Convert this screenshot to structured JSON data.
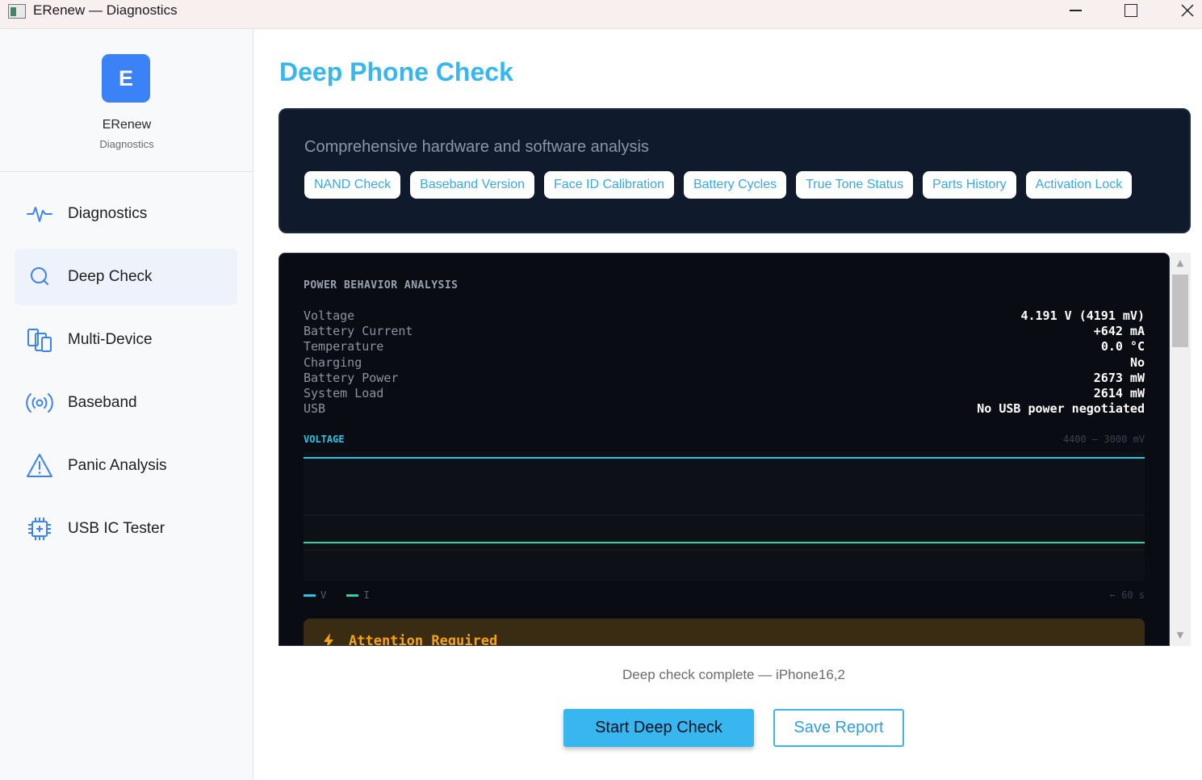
{
  "window": {
    "title": "ERenew — Diagnostics",
    "controls": [
      "minimize-icon",
      "maximize-icon",
      "close-icon"
    ]
  },
  "sidebar": {
    "logo_letter": "E",
    "brand_name": "ERenew",
    "brand_sub": "Diagnostics",
    "accent": "#3b82f6",
    "active_index": 1,
    "items": [
      {
        "label": "Diagnostics",
        "icon": "activity-pulse-icon"
      },
      {
        "label": "Deep Check",
        "icon": "search-icon"
      },
      {
        "label": "Multi-Device",
        "icon": "devices-icon"
      },
      {
        "label": "Baseband",
        "icon": "broadcast-signal-icon"
      },
      {
        "label": "Panic Analysis",
        "icon": "warning-triangle-icon"
      },
      {
        "label": "USB IC Tester",
        "icon": "chip-icon"
      }
    ]
  },
  "main": {
    "title": "Deep Phone Check",
    "title_color": "#38b6f0",
    "hero": {
      "subtitle": "Comprehensive hardware and software analysis",
      "chips": [
        "NAND Check",
        "Baseband Version",
        "Face ID Calibration",
        "Battery Cycles",
        "True Tone Status",
        "Parts History",
        "Activation Lock"
      ]
    },
    "power": {
      "section_title": "POWER BEHAVIOR ANALYSIS",
      "metrics": [
        {
          "label": "Voltage",
          "value": "4.191 V  (4191 mV)"
        },
        {
          "label": "Battery Current",
          "value": "+642 mA"
        },
        {
          "label": "Temperature",
          "value": "0.0 °C"
        },
        {
          "label": "Charging",
          "value": "No"
        },
        {
          "label": "Battery Power",
          "value": "2673 mW"
        },
        {
          "label": "System Load",
          "value": "2614 mW"
        },
        {
          "label": "USB",
          "value": "No USB power negotiated"
        }
      ],
      "chart_title": "VOLTAGE",
      "chart_range": "4400 — 3000 mV",
      "legend": [
        {
          "label": "V",
          "color": "#26c6e4"
        },
        {
          "label": "I",
          "color": "#2ed3a0"
        }
      ],
      "time_label": "← 60 s",
      "attention": "Attention Required"
    },
    "status": "Deep check complete — iPhone16,2",
    "buttons": {
      "start": "Start Deep Check",
      "save": "Save Report"
    }
  }
}
